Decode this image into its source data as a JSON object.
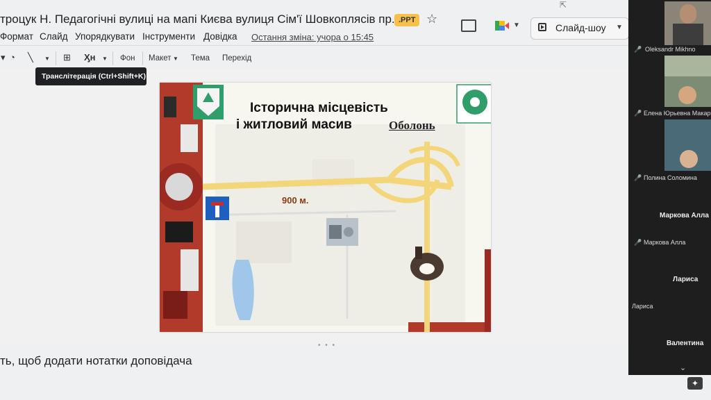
{
  "header": {
    "title": "троцук Н. Педагогічні вулиці на мапі Києва вулиця Сім'ї Шовкоплясів пр...",
    "badge": ".PPT",
    "slideshow_label": "Слайд-шоу"
  },
  "menu": {
    "items": [
      "Формат",
      "Слайд",
      "Упорядкувати",
      "Інструменти",
      "Довідка"
    ],
    "last_edit": "Остання зміна: учора о 15:45"
  },
  "toolbar": {
    "background": "Фон",
    "layout": "Макет",
    "theme": "Тема",
    "transition": "Перехід",
    "tooltip": "Транслітерація (Ctrl+Shift+K)"
  },
  "slide": {
    "title_line1": "Історична місцевість",
    "title_line2": "і житловий масив",
    "title_name": "Оболонь",
    "distance": "900 м."
  },
  "notes": {
    "placeholder": "ть, щоб додати нотатки доповідача"
  },
  "participants": [
    {
      "name": "Oleksandr Mikhno",
      "muted": true
    },
    {
      "name": "Елена Юрьевна Макар",
      "muted": true
    },
    {
      "name": "Полина Соломина",
      "muted": true
    },
    {
      "name": "Маркова Алла",
      "tile_label": "Маркова Алла",
      "muted": true
    },
    {
      "name": "Лариса",
      "tile_label": "Лариса",
      "muted": false
    },
    {
      "tile_label": "Валентина"
    }
  ],
  "colors": {
    "badge": "#f7c04a",
    "road": "#f3d67a",
    "road_sign": "#1f5fbf",
    "distance_text": "#8a3a10",
    "mute_icon": "#e34"
  }
}
